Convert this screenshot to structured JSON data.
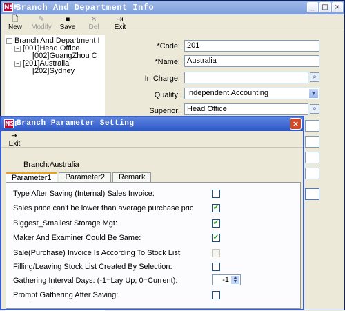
{
  "main": {
    "title": "Branch And Department Info",
    "icon": "NSF",
    "toolbar": {
      "new": "New",
      "modify": "Modify",
      "save": "Save",
      "del": "Del",
      "exit": "Exit"
    },
    "tree": [
      {
        "label": "Branch And Department I"
      },
      {
        "label": "[001]Head Office"
      },
      {
        "label": "[002]GuangZhou C"
      },
      {
        "label": "[201]Australia"
      },
      {
        "label": "[202]Sydney"
      }
    ],
    "form": {
      "code_label": "*Code:",
      "code_value": "201",
      "name_label": "*Name:",
      "name_value": "Australia",
      "incharge_label": "In Charge:",
      "incharge_value": "",
      "quality_label": "Quality:",
      "quality_value": "Independent Accounting",
      "superior_label": "Superior:",
      "superior_value": "Head Office"
    }
  },
  "dialog": {
    "title": "Branch Parameter Setting",
    "icon": "NSF",
    "exit_label": "Exit",
    "branch_text": "Branch:Australia",
    "tabs": [
      "Parameter1",
      "Parameter2",
      "Remark"
    ],
    "params": [
      {
        "label": "Type After Saving (Internal) Sales Invoice:",
        "checked": false
      },
      {
        "label": "Sales price can't be lower than average purchase pric",
        "checked": true
      },
      {
        "label": "Biggest_Smallest Storage Mgt:",
        "checked": true
      },
      {
        "label": "Maker And Examiner Could Be Same:",
        "checked": true
      },
      {
        "label": "Sale(Purchase) Invoice Is According To Stock List:",
        "checked": false,
        "disabled": true
      },
      {
        "label": "Filling/Leaving Stock List Created By Selection:",
        "checked": false
      },
      {
        "label": "Gathering Interval Days: (-1=Lay Up; 0=Current):",
        "spin": "-1"
      },
      {
        "label": "Prompt Gathering After Saving:",
        "checked": false
      }
    ]
  }
}
